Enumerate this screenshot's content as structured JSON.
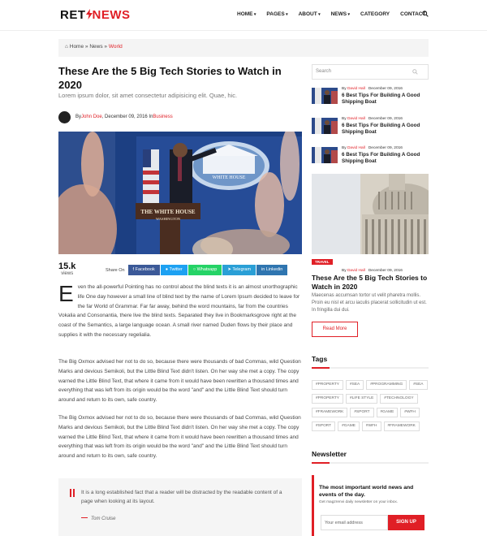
{
  "header": {
    "logo_a": "RET",
    "logo_b": "NEWS",
    "nav": [
      {
        "label": "HOME",
        "dropdown": true
      },
      {
        "label": "PAGES",
        "dropdown": true
      },
      {
        "label": "ABOUT",
        "dropdown": true
      },
      {
        "label": "NEWS",
        "dropdown": true
      },
      {
        "label": "CATEGORY",
        "dropdown": false
      },
      {
        "label": "CONTACT",
        "dropdown": false
      }
    ],
    "search_icon": "search-icon"
  },
  "breadcrumb": {
    "home": "Home",
    "news": "News",
    "current": "World",
    "home_icon": "home-icon"
  },
  "article": {
    "title": "These Are the 5 Big Tech Stories to Watch in 2020",
    "subtitle": "Lorem ipsum dolor, sit amet consectetur adipisicing elit. Quae, hic.",
    "by": "By ",
    "author": "John Doe",
    "date_sep": ",  December 09, 2016 In ",
    "category": "Business",
    "views_num": "15.k",
    "views_label": "views",
    "share_label": "Share On",
    "share": [
      {
        "label": "Facebook",
        "color": "#3b5998",
        "icon": "facebook-icon"
      },
      {
        "label": "Twitter",
        "color": "#1da1f2",
        "icon": "twitter-icon"
      },
      {
        "label": "Whatsapp",
        "color": "#25d366",
        "icon": "whatsapp-icon"
      },
      {
        "label": "Telegram",
        "color": "#2a9fd6",
        "icon": "telegram-icon"
      },
      {
        "label": "Linkedin",
        "color": "#2f75b0",
        "icon": "linkedin-icon"
      }
    ],
    "dropcap": "E",
    "p1": "ven the all-powerful Pointing has no control about the blind texts it is an almost unorthographic life One day however a small line of blind text by the name of Lorem Ipsum decided to leave for the far World of Grammar. Far far away, behind the word mountains, far from the countries Vokalia and Consonantia, there live the blind texts. Separated they live in Bookmarksgrove right at the coast of the Semantics, a large language ocean. A small river named Duden flows by their place and supplies it with the necessary regelialia.",
    "p2": "The Big Oxmox advised her not to do so, because there were thousands of bad Commas, wild Question Marks and devious Semikoli, but the Little Blind Text didn't listen. On her way she met a copy. The copy warned the Little Blind Text, that where it came from it would have been rewritten a thousand times and everything that was left from its origin would be the word \"and\" and the Little Blind Text should turn around and return to its own, safe country.",
    "p3": "The Big Oxmox advised her not to do so, because there were thousands of bad Commas, wild Question Marks and devious Semikoli, but the Little Blind Text didn't listen. On her way she met a copy. The copy warned the Little Blind Text, that where it came from it would have been rewritten a thousand times and everything that was left from its origin would be the word \"and\" and the Little Blind Text should turn around and return to its own, safe country.",
    "quote": "It is a long established fact that a reader will be distracted by the readable content of a page when looking at its layout.",
    "quote_author": "Tom Cruise",
    "hero_sign": "THE WHITE HOUSE",
    "hero_sub": "WASHINGTON",
    "hero_seal": "WHITE HOUSE"
  },
  "sidebar": {
    "search_placeholder": "Search",
    "posts": [
      {
        "by": "By ",
        "author": "David Hall",
        "date": "December 09, 2016",
        "title": "6 Best Tips For Building A Good Shipping Boat"
      },
      {
        "by": "By ",
        "author": "David Hall",
        "date": "December 09, 2016",
        "title": "6 Best Tips For Building A Good Shipping Boat"
      },
      {
        "by": "By ",
        "author": "David Hall",
        "date": "December 09, 2016",
        "title": "6 Best Tips For Building A Good Shipping Boat"
      }
    ],
    "feature": {
      "tag": "TRAVEL",
      "by": "By ",
      "author": "David Hall",
      "date": "December 09, 2016",
      "title": "These Are the 5 Big Tech Stories to Watch in 2020",
      "text": "Maecenas accumsan tortor ut velit pharetra mollis. Proin eu nisl et arcu iaculis placerat sollicitudin ut est. In fringilla dui dui.",
      "button": "Read More"
    },
    "tags_title": "Tags",
    "tags": [
      "#PROPERTY",
      "#SEA",
      "#PROGRAMMING",
      "#SEA",
      "#PROPERTY",
      "#LIFE STYLE",
      "#TECHNOLOGY",
      "#FRAMEWORK",
      "#SPORT",
      "#GAME",
      "#WFH",
      "#SPORT",
      "#GAME",
      "#WFH",
      "#FRAMEWORK"
    ],
    "newsletter_title": "Newsletter",
    "newsletter_head": "The most important world news and events of the day.",
    "newsletter_sub": "Get magzrenvi daily newsletter on your inbox.",
    "email_placeholder": "Your email address",
    "signup": "SIGN UP"
  },
  "colors": {
    "accent": "#e01f26",
    "text": "#222222",
    "muted": "#777777"
  }
}
